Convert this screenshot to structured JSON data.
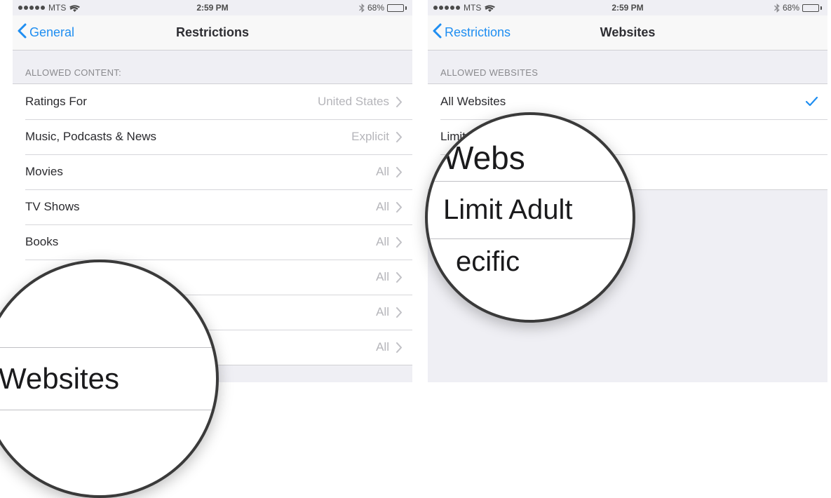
{
  "status": {
    "carrier": "MTS",
    "time": "2:59 PM",
    "battery_pct": "68%",
    "battery_level": 0.68
  },
  "left": {
    "nav": {
      "back": "General",
      "title": "Restrictions"
    },
    "section_header": "Allowed Content:",
    "rows": [
      {
        "label": "Ratings For",
        "value": "United States"
      },
      {
        "label": "Music, Podcasts & News",
        "value": "Explicit"
      },
      {
        "label": "Movies",
        "value": "All"
      },
      {
        "label": "TV Shows",
        "value": "All"
      },
      {
        "label": "Books",
        "value": "All"
      },
      {
        "label": "",
        "value": "All"
      },
      {
        "label": "",
        "value": "All"
      },
      {
        "label": "",
        "value": "All"
      }
    ],
    "magnifier_text": "Websites"
  },
  "right": {
    "nav": {
      "back": "Restrictions",
      "title": "Websites"
    },
    "section_header": "Allowed Websites",
    "options": [
      {
        "label": "All Websites",
        "checked": true
      },
      {
        "label": "Limit Adult Content",
        "checked": false
      },
      {
        "label": "Specific Websites Only",
        "checked": false
      }
    ],
    "magnifier_top_partial": "Webs",
    "magnifier_main": "Limit Adult",
    "magnifier_bot_partial": "ecific"
  }
}
